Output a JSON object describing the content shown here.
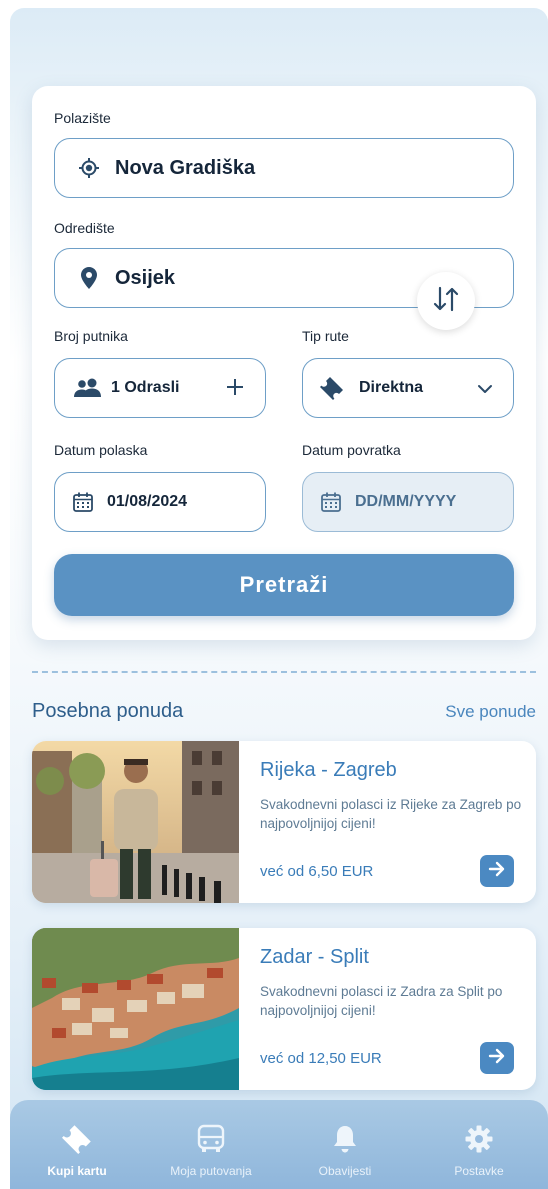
{
  "form": {
    "origin_label": "Polazište",
    "origin_value": "Nova Gradiška",
    "destination_label": "Odredište",
    "destination_value": "Osijek",
    "passengers_label": "Broj putnika",
    "passengers_value": "1 Odrasli",
    "route_type_label": "Tip rute",
    "route_type_value": "Direktna",
    "departure_label": "Datum polaska",
    "departure_value": "01/08/2024",
    "return_label": "Datum povratka",
    "return_placeholder": "DD/MM/YYYY",
    "search_button": "Pretraži"
  },
  "offers": {
    "section_title": "Posebna ponuda",
    "see_all": "Sve ponude",
    "items": [
      {
        "title": "Rijeka - Zagreb",
        "description": "Svakodnevni polasci iz Rijeke za Zagreb po najpovoljnijoj cijeni!",
        "price": "već od 6,50 EUR"
      },
      {
        "title": "Zadar - Split",
        "description": "Svakodnevni polasci iz Zadra za Split po najpovoljnijoj cijeni!",
        "price": "već od 12,50 EUR"
      }
    ]
  },
  "tabbar": {
    "tabs": [
      {
        "label": "Kupi kartu",
        "icon": "ticket-icon",
        "active": true
      },
      {
        "label": "Moja putovanja",
        "icon": "bus-icon",
        "active": false
      },
      {
        "label": "Obavijesti",
        "icon": "bell-icon",
        "active": false
      },
      {
        "label": "Postavke",
        "icon": "gear-icon",
        "active": false
      }
    ]
  },
  "colors": {
    "accent": "#5a92c3",
    "text_dark": "#15263a",
    "link": "#3a7cb8"
  }
}
